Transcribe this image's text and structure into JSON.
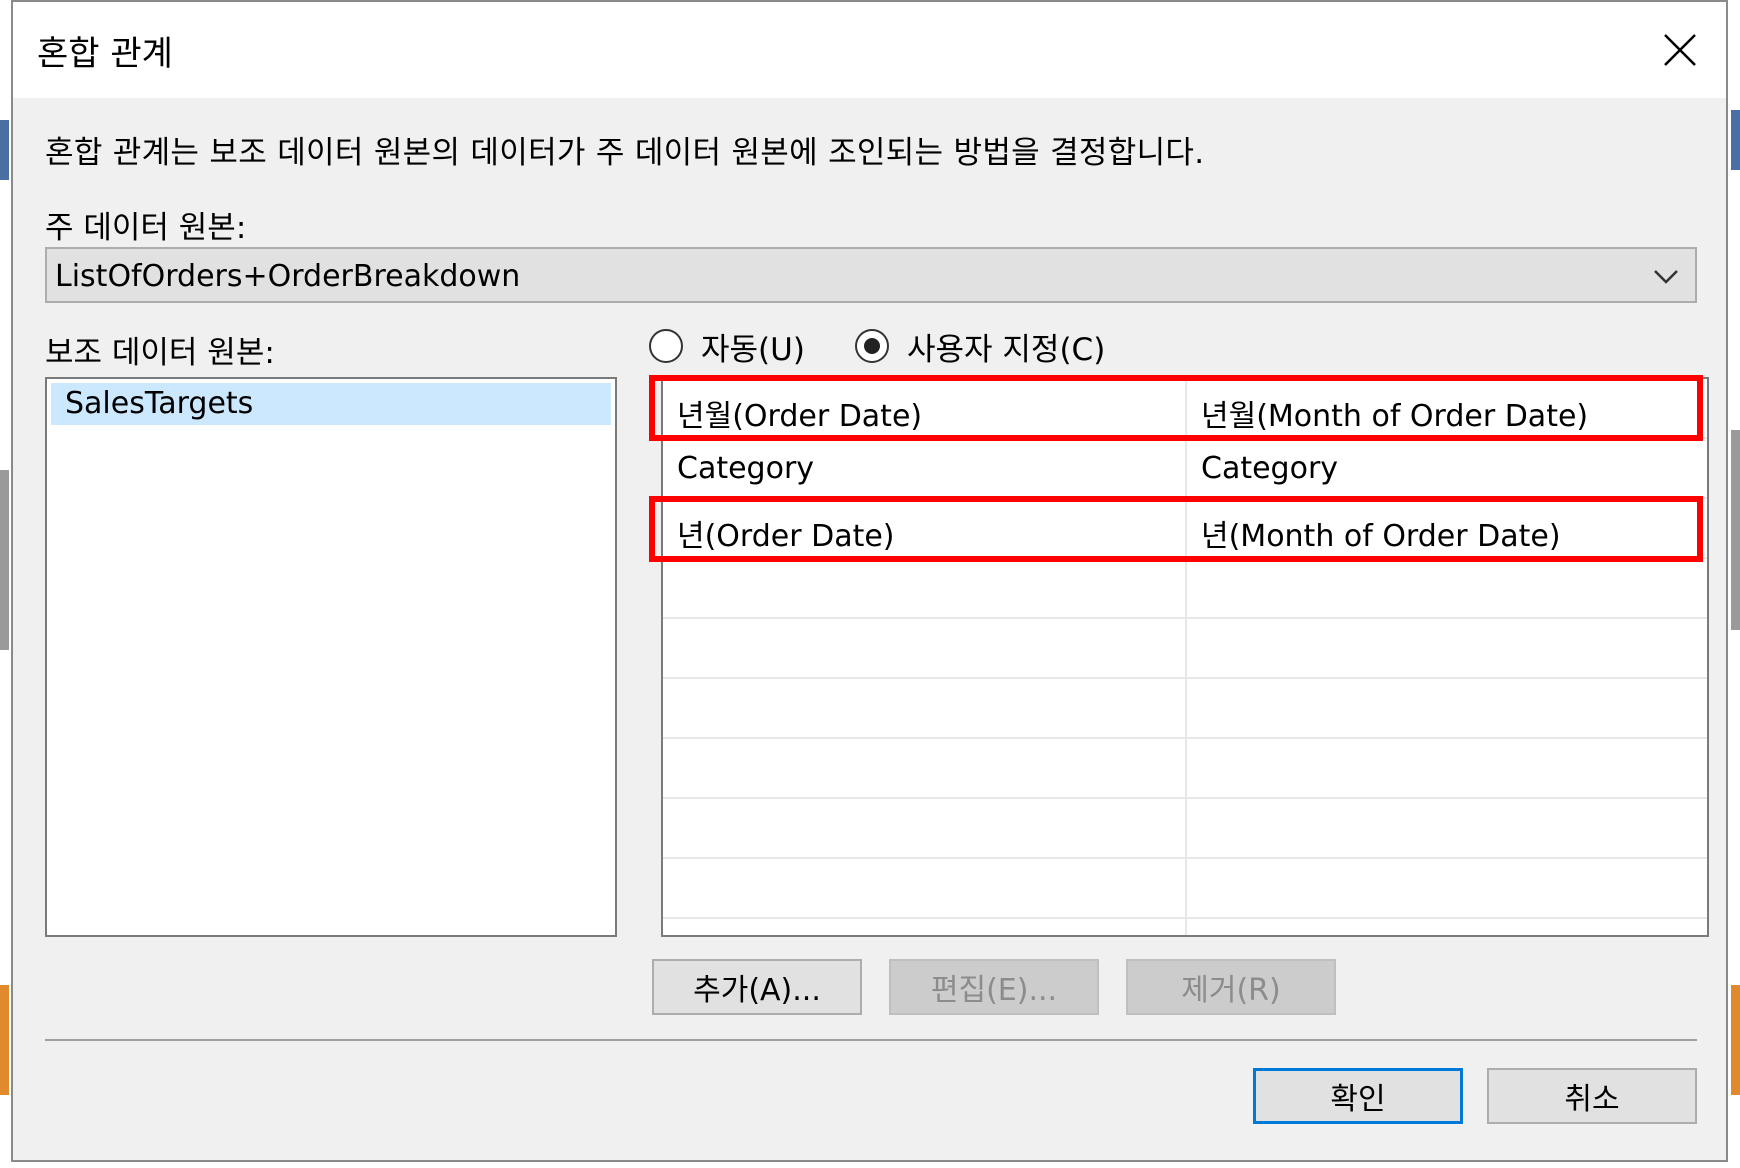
{
  "dialog": {
    "title": "혼합 관계",
    "description": "혼합 관계는 보조 데이터 원본의 데이터가 주 데이터 원본에 조인되는 방법을 결정합니다.",
    "primary_label": "주 데이터 원본:",
    "primary_value": "ListOfOrders+OrderBreakdown",
    "secondary_label": "보조 데이터 원본:",
    "secondary_items": [
      "SalesTargets"
    ],
    "radio_auto": "자동(U)",
    "radio_custom": "사용자 지정(C)",
    "selected_mode": "custom",
    "mappings": [
      {
        "left": "년월(Order Date)",
        "right": "년월(Month of Order Date)",
        "highlighted": true
      },
      {
        "left": "Category",
        "right": "Category",
        "highlighted": false
      },
      {
        "left": "년(Order Date)",
        "right": "년(Month of Order Date)",
        "highlighted": true
      }
    ],
    "buttons": {
      "add": "추가(A)...",
      "edit": "편집(E)...",
      "remove": "제거(R)",
      "ok": "확인",
      "cancel": "취소"
    },
    "colors": {
      "highlight": "#ff0000",
      "selection": "#cce8ff",
      "default_button_border": "#0078d7"
    }
  }
}
